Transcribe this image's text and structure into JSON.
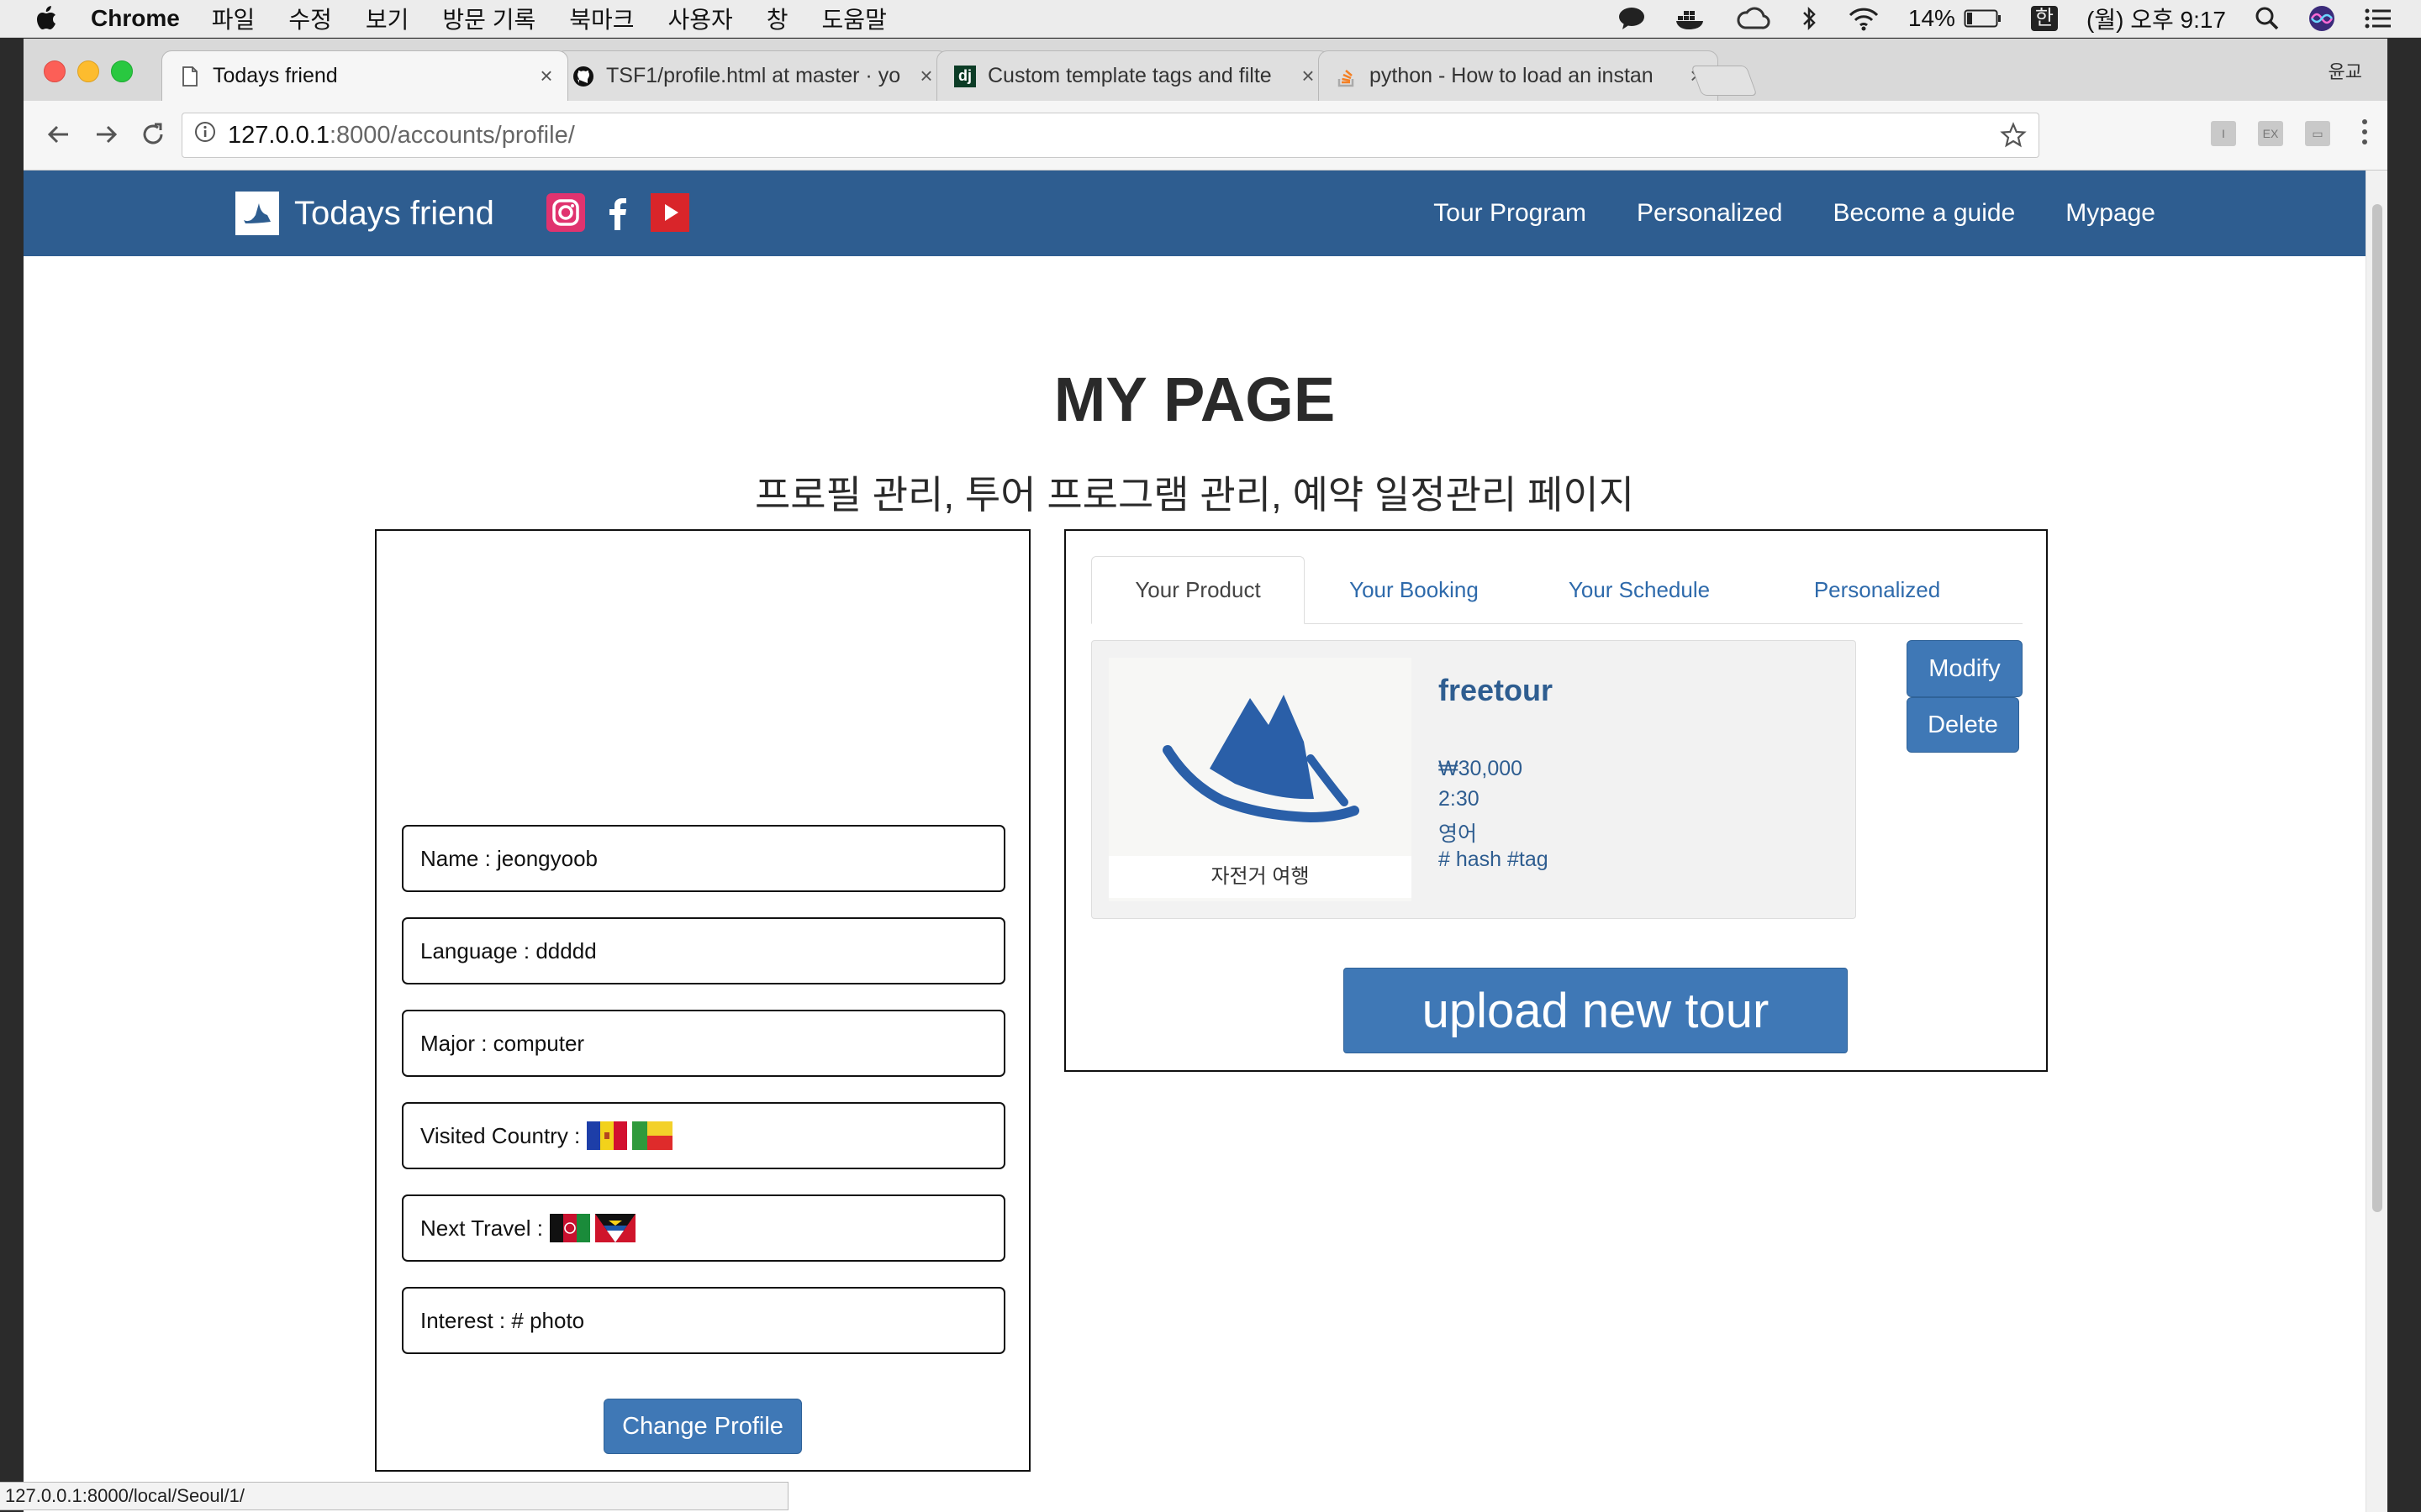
{
  "menubar": {
    "app_name": "Chrome",
    "items": [
      "파일",
      "수정",
      "보기",
      "방문 기록",
      "북마크",
      "사용자",
      "창",
      "도움말"
    ],
    "battery": "14%",
    "input_method": "한",
    "clock": "(월) 오후 9:17"
  },
  "browser": {
    "tabs": [
      {
        "title": "Todays friend",
        "icon": "page-icon",
        "active": true
      },
      {
        "title": "TSF1/profile.html at master · yo",
        "icon": "github-icon",
        "active": false
      },
      {
        "title": "Custom template tags and filte",
        "icon": "django-icon",
        "active": false
      },
      {
        "title": "python - How to load an instan",
        "icon": "stackoverflow-icon",
        "active": false
      }
    ],
    "tab_close": "×",
    "profile": "윤교",
    "url_host": "127.0.0.1",
    "url_path": ":8000/accounts/profile/",
    "status_url": "127.0.0.1:8000/local/Seoul/1/"
  },
  "site": {
    "brand": "Todays friend",
    "social": [
      "instagram-icon",
      "facebook-icon",
      "youtube-icon"
    ],
    "nav": [
      "Tour Program",
      "Personalized",
      "Become a guide",
      "Mypage"
    ],
    "colors": {
      "navbar": "#2e5d90",
      "button": "#3f78b6",
      "link": "#2e6aab"
    }
  },
  "page": {
    "title": "MY PAGE",
    "subtitle": "프로필 관리, 투어 프로그램 관리, 예약 일정관리 페이지"
  },
  "profile": {
    "name": "Name : jeongyoob",
    "language": "Language : ddddd",
    "major": "Major : computer",
    "visited_label": "Visited Country :",
    "visited_flags": [
      "andorra-flag",
      "benin-flag"
    ],
    "next_label": "Next Travel :",
    "next_flags": [
      "afghanistan-flag",
      "antigua-flag"
    ],
    "interest": "Interest : # photo",
    "change_button": "Change Profile"
  },
  "product_panel": {
    "tabs": [
      "Your Product",
      "Your Booking",
      "Your Schedule",
      "Personalized"
    ],
    "active_tab": "Your Product",
    "product": {
      "title": "freetour",
      "price": "₩30,000",
      "duration": "2:30",
      "language": "영어",
      "tags": "# hash #tag",
      "image_caption": "자전거 여행"
    },
    "modify_button": "Modify",
    "delete_button": "Delete",
    "upload_button": "upload new tour"
  }
}
